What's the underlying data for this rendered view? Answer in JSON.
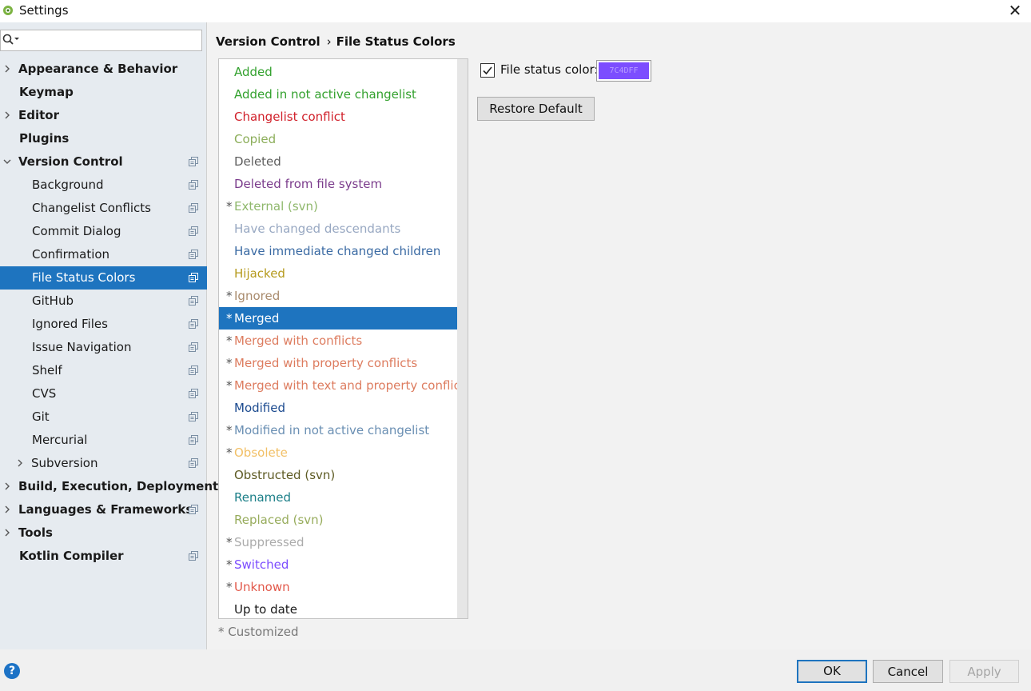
{
  "window": {
    "title": "Settings",
    "close_glyph": "✕"
  },
  "sidebar": {
    "search_value": "",
    "items": [
      {
        "label": "Appearance & Behavior",
        "level": 0,
        "bold": true,
        "arrow": "right",
        "config": false,
        "selected": false
      },
      {
        "label": "Keymap",
        "level": 0,
        "bold": true,
        "arrow": "none",
        "config": false,
        "selected": false
      },
      {
        "label": "Editor",
        "level": 0,
        "bold": true,
        "arrow": "right",
        "config": false,
        "selected": false
      },
      {
        "label": "Plugins",
        "level": 0,
        "bold": true,
        "arrow": "none",
        "config": false,
        "selected": false
      },
      {
        "label": "Version Control",
        "level": 0,
        "bold": true,
        "arrow": "down",
        "config": true,
        "selected": false
      },
      {
        "label": "Background",
        "level": 1,
        "bold": false,
        "arrow": "none",
        "config": true,
        "selected": false
      },
      {
        "label": "Changelist Conflicts",
        "level": 1,
        "bold": false,
        "arrow": "none",
        "config": true,
        "selected": false
      },
      {
        "label": "Commit Dialog",
        "level": 1,
        "bold": false,
        "arrow": "none",
        "config": true,
        "selected": false
      },
      {
        "label": "Confirmation",
        "level": 1,
        "bold": false,
        "arrow": "none",
        "config": true,
        "selected": false
      },
      {
        "label": "File Status Colors",
        "level": 1,
        "bold": false,
        "arrow": "none",
        "config": true,
        "selected": true
      },
      {
        "label": "GitHub",
        "level": 1,
        "bold": false,
        "arrow": "none",
        "config": true,
        "selected": false
      },
      {
        "label": "Ignored Files",
        "level": 1,
        "bold": false,
        "arrow": "none",
        "config": true,
        "selected": false
      },
      {
        "label": "Issue Navigation",
        "level": 1,
        "bold": false,
        "arrow": "none",
        "config": true,
        "selected": false
      },
      {
        "label": "Shelf",
        "level": 1,
        "bold": false,
        "arrow": "none",
        "config": true,
        "selected": false
      },
      {
        "label": "CVS",
        "level": 1,
        "bold": false,
        "arrow": "none",
        "config": true,
        "selected": false
      },
      {
        "label": "Git",
        "level": 1,
        "bold": false,
        "arrow": "none",
        "config": true,
        "selected": false
      },
      {
        "label": "Mercurial",
        "level": 1,
        "bold": false,
        "arrow": "none",
        "config": true,
        "selected": false
      },
      {
        "label": "Subversion",
        "level": 1,
        "bold": false,
        "arrow": "right",
        "config": true,
        "selected": false
      },
      {
        "label": "Build, Execution, Deployment",
        "level": 0,
        "bold": true,
        "arrow": "right",
        "config": false,
        "selected": false
      },
      {
        "label": "Languages & Frameworks",
        "level": 0,
        "bold": true,
        "arrow": "right",
        "config": true,
        "selected": false
      },
      {
        "label": "Tools",
        "level": 0,
        "bold": true,
        "arrow": "right",
        "config": false,
        "selected": false
      },
      {
        "label": "Kotlin Compiler",
        "level": 0,
        "bold": true,
        "arrow": "none",
        "config": true,
        "selected": false
      }
    ]
  },
  "breadcrumb": {
    "parent": "Version Control",
    "separator": "›",
    "current": "File Status Colors"
  },
  "statuses": [
    {
      "name": "Added",
      "color": "#33a12e",
      "customized": false
    },
    {
      "name": "Added in not active changelist",
      "color": "#33a12e",
      "customized": false
    },
    {
      "name": "Changelist conflict",
      "color": "#d1212b",
      "customized": false
    },
    {
      "name": "Copied",
      "color": "#8cae5a",
      "customized": false
    },
    {
      "name": "Deleted",
      "color": "#5e5e5e",
      "customized": false
    },
    {
      "name": "Deleted from file system",
      "color": "#7b3c8c",
      "customized": false
    },
    {
      "name": "External (svn)",
      "color": "#8fb86c",
      "customized": true
    },
    {
      "name": "Have changed descendants",
      "color": "#98a8c2",
      "customized": false
    },
    {
      "name": "Have immediate changed children",
      "color": "#3a6aa3",
      "customized": false
    },
    {
      "name": "Hijacked",
      "color": "#b59a1d",
      "customized": false
    },
    {
      "name": "Ignored",
      "color": "#a98b6d",
      "customized": true
    },
    {
      "name": "Merged",
      "color": "#ffffff",
      "customized": true,
      "selected": true
    },
    {
      "name": "Merged with conflicts",
      "color": "#dd7c5f",
      "customized": true
    },
    {
      "name": "Merged with property conflicts",
      "color": "#dd7c5f",
      "customized": true
    },
    {
      "name": "Merged with text and property conflicts",
      "color": "#dd7c5f",
      "customized": true
    },
    {
      "name": "Modified",
      "color": "#1b4a8f",
      "customized": false
    },
    {
      "name": "Modified in not active changelist",
      "color": "#6a8fb3",
      "customized": true
    },
    {
      "name": "Obsolete",
      "color": "#f2c067",
      "customized": true
    },
    {
      "name": "Obstructed (svn)",
      "color": "#5e5b24",
      "customized": false
    },
    {
      "name": "Renamed",
      "color": "#1c7f88",
      "customized": false
    },
    {
      "name": "Replaced (svn)",
      "color": "#97ac5c",
      "customized": false
    },
    {
      "name": "Suppressed",
      "color": "#ababab",
      "customized": true
    },
    {
      "name": "Switched",
      "color": "#7c4dff",
      "customized": true
    },
    {
      "name": "Unknown",
      "color": "#e2594b",
      "customized": true
    },
    {
      "name": "Up to date",
      "color": "#1a1a1a",
      "customized": false
    }
  ],
  "customized_note": "* Customized",
  "file_status": {
    "checkbox_label": "File status color:",
    "checked": true,
    "color_hex": "7C4DFF",
    "swatch_color": "#7c4dff"
  },
  "buttons": {
    "restore_default": "Restore Default",
    "ok": "OK",
    "cancel": "Cancel",
    "apply": "Apply",
    "help": "?"
  },
  "colors": {
    "selection": "#1e74bf",
    "sidebar_bg": "#e6ebf0"
  },
  "icons": {
    "app": "android-icon",
    "search": "search-icon",
    "config": "project-config-icon",
    "help": "help-icon"
  }
}
